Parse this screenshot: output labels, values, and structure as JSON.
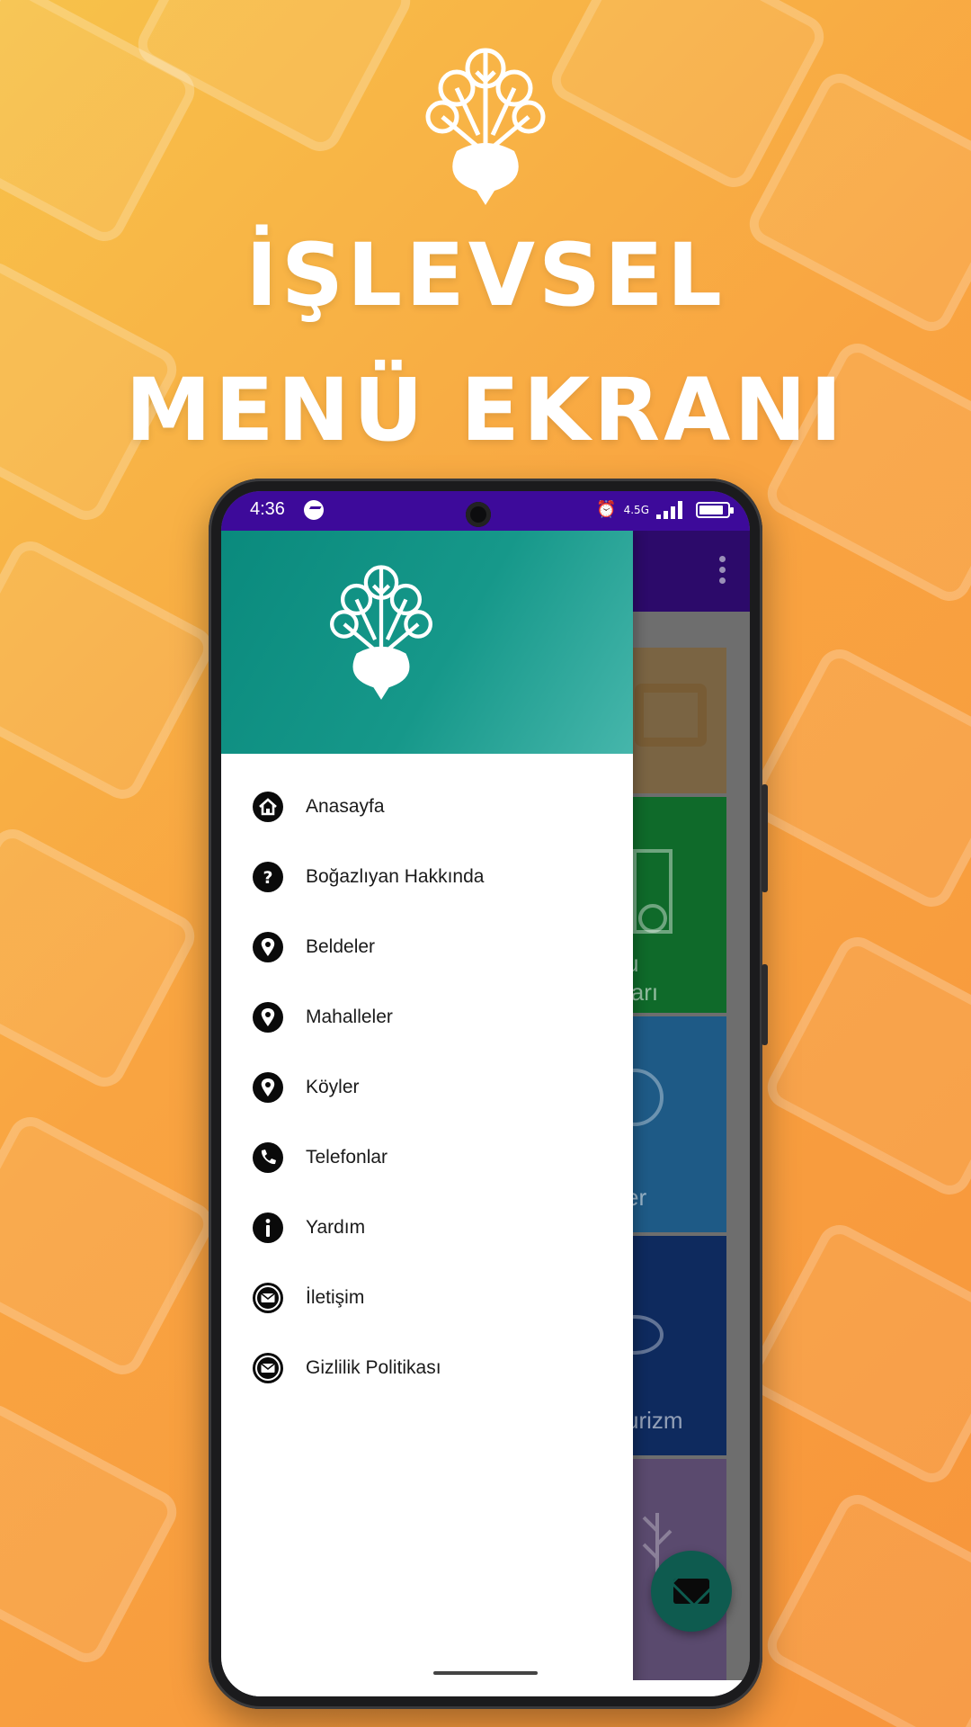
{
  "hero": {
    "title_line1": "İŞLEVSEL",
    "title_line2": "MENÜ EKRANI"
  },
  "status_bar": {
    "time": "4:36",
    "network": "4.5G"
  },
  "drawer": {
    "items": [
      {
        "label": "Anasayfa",
        "icon": "home-icon"
      },
      {
        "label": "Boğazlıyan Hakkında",
        "icon": "help-icon"
      },
      {
        "label": "Beldeler",
        "icon": "location-pin-icon"
      },
      {
        "label": "Mahalleler",
        "icon": "location-pin-icon"
      },
      {
        "label": "Köyler",
        "icon": "location-pin-icon"
      },
      {
        "label": "Telefonlar",
        "icon": "phone-icon"
      },
      {
        "label": "Yardım",
        "icon": "info-icon"
      },
      {
        "label": "İletişim",
        "icon": "mail-icon"
      },
      {
        "label": "Gizlilik Politikası",
        "icon": "mail-icon"
      }
    ]
  },
  "background_cards": [
    {
      "label": "u",
      "label2": "ları",
      "color": "#0f6a2a"
    },
    {
      "label": "er",
      "color": "#1e5a86"
    },
    {
      "label": "urizm",
      "color": "#0e2a5e"
    }
  ],
  "colors": {
    "accent_teal": "#0a8a7d",
    "status_bar": "#3d0a9a",
    "background_orange": "#f9a441"
  }
}
